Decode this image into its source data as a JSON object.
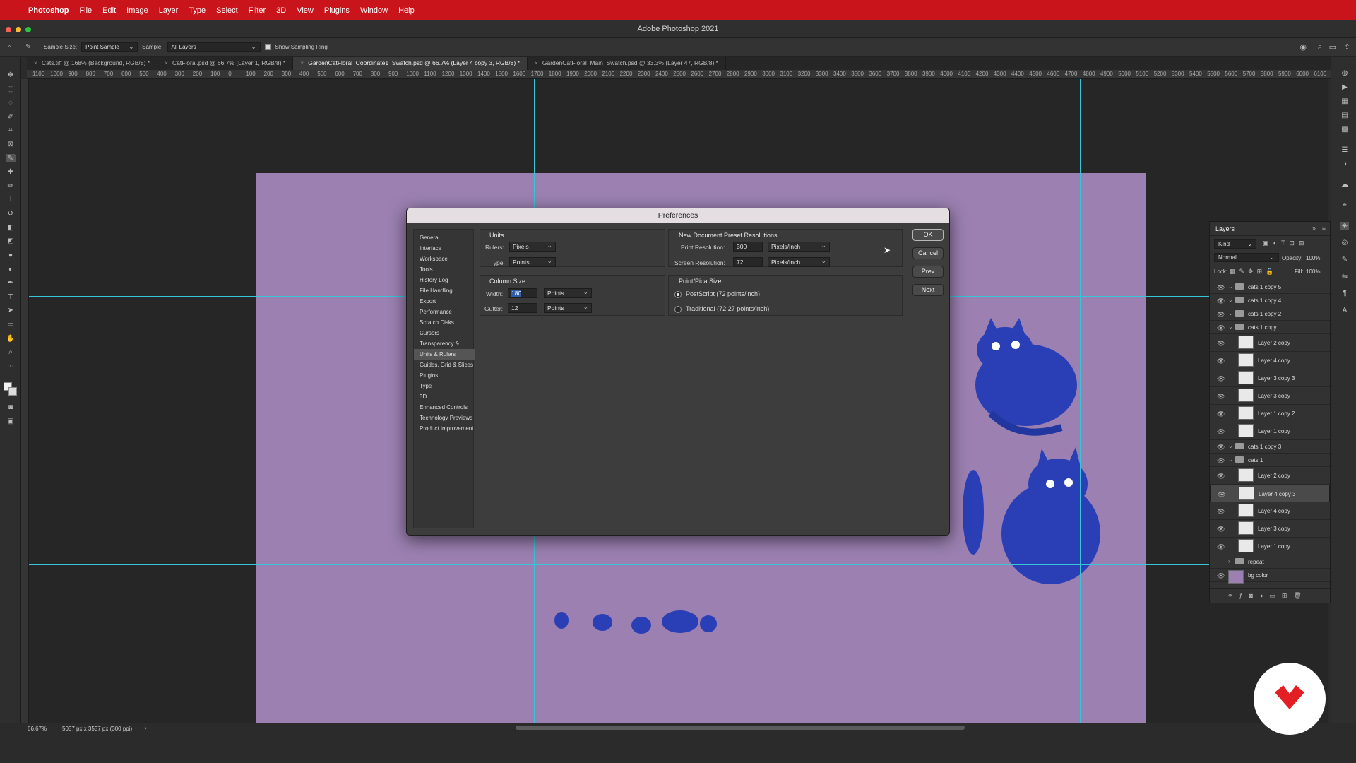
{
  "menubar": {
    "app": "Photoshop",
    "items": [
      "File",
      "Edit",
      "Image",
      "Layer",
      "Type",
      "Select",
      "Filter",
      "3D",
      "View",
      "Plugins",
      "Window",
      "Help"
    ]
  },
  "window": {
    "title": "Adobe Photoshop 2021"
  },
  "options_bar": {
    "sample_size_label": "Sample Size:",
    "sample_size_value": "Point Sample",
    "sample_label": "Sample:",
    "sample_value": "All Layers",
    "show_ring_label": "Show Sampling Ring"
  },
  "tabs": [
    "Cats.tiff @ 168% (Background, RGB/8) *",
    "CatFloral.psd @ 66.7% (Layer 1, RGB/8) *",
    "GardenCatFloral_Coordinate1_Swatch.psd @ 66.7% (Layer 4 copy 3, RGB/8) *",
    "GardenCatFloral_Main_Swatch.psd @ 33.3% (Layer 47, RGB/8) *"
  ],
  "ruler_ticks": [
    "1100",
    "1000",
    "900",
    "800",
    "700",
    "600",
    "500",
    "400",
    "300",
    "200",
    "100",
    "0",
    "100",
    "200",
    "300",
    "400",
    "500",
    "600",
    "700",
    "800",
    "900",
    "1000",
    "1100",
    "1200",
    "1300",
    "1400",
    "1500",
    "1600",
    "1700",
    "1800",
    "1900",
    "2000",
    "2100",
    "2200",
    "2300",
    "2400",
    "2500",
    "2600",
    "2700",
    "2800",
    "2900",
    "3000",
    "3100",
    "3200",
    "3300",
    "3400",
    "3500",
    "3600",
    "3700",
    "3800",
    "3900",
    "4000",
    "4100",
    "4200",
    "4300",
    "4400",
    "4500",
    "4600",
    "4700",
    "4800",
    "4900",
    "5000",
    "5100",
    "5200",
    "5300",
    "5400",
    "5500",
    "5600",
    "5700",
    "5800",
    "5900",
    "6000",
    "6100"
  ],
  "dialog": {
    "title": "Preferences",
    "categories": [
      "General",
      "Interface",
      "Workspace",
      "Tools",
      "History Log",
      "File Handling",
      "Export",
      "Performance",
      "Scratch Disks",
      "Cursors",
      "Transparency & Gamut",
      "Units & Rulers",
      "Guides, Grid & Slices",
      "Plugins",
      "Type",
      "3D",
      "Enhanced Controls",
      "Technology Previews",
      "Product Improvement"
    ],
    "active_category": "Units & Rulers",
    "units": {
      "title": "Units",
      "rulers_label": "Rulers:",
      "rulers_value": "Pixels",
      "type_label": "Type:",
      "type_value": "Points"
    },
    "column_size": {
      "title": "Column Size",
      "width_label": "Width:",
      "width_value": "180",
      "width_unit": "Points",
      "gutter_label": "Gutter:",
      "gutter_value": "12",
      "gutter_unit": "Points"
    },
    "resolutions": {
      "title": "New Document Preset Resolutions",
      "print_label": "Print Resolution:",
      "print_value": "300",
      "print_unit": "Pixels/Inch",
      "screen_label": "Screen Resolution:",
      "screen_value": "72",
      "screen_unit": "Pixels/Inch"
    },
    "point_size": {
      "title": "Point/Pica Size",
      "postscript": "PostScript (72 points/inch)",
      "traditional": "Traditional (72.27 points/inch)",
      "selected": "postscript"
    },
    "buttons": {
      "ok": "OK",
      "cancel": "Cancel",
      "prev": "Prev",
      "next": "Next"
    }
  },
  "layers_panel": {
    "title": "Layers",
    "filter": "Kind",
    "blend_mode": "Normal",
    "opacity_label": "Opacity:",
    "opacity_value": "100%",
    "lock_label": "Lock:",
    "fill_label": "Fill:",
    "fill_value": "100%",
    "rows": [
      {
        "name": "cats 1 copy 5",
        "type": "group"
      },
      {
        "name": "cats 1 copy 4",
        "type": "group"
      },
      {
        "name": "cats 1 copy 2",
        "type": "group"
      },
      {
        "name": "cats 1 copy",
        "type": "group"
      },
      {
        "name": "Layer 2 copy",
        "type": "layer"
      },
      {
        "name": "Layer 4 copy",
        "type": "layer"
      },
      {
        "name": "Layer 3 copy 3",
        "type": "layer"
      },
      {
        "name": "Layer 3 copy",
        "type": "layer"
      },
      {
        "name": "Layer 1 copy 2",
        "type": "layer"
      },
      {
        "name": "Layer 1 copy",
        "type": "layer"
      },
      {
        "name": "cats 1 copy 3",
        "type": "group"
      },
      {
        "name": "cats 1",
        "type": "group"
      },
      {
        "name": "Layer 2 copy",
        "type": "layer"
      },
      {
        "name": "Layer 4 copy 3",
        "type": "layer",
        "selected": true
      },
      {
        "name": "Layer 4 copy",
        "type": "layer"
      },
      {
        "name": "Layer 3 copy",
        "type": "layer"
      },
      {
        "name": "Layer 1 copy",
        "type": "layer"
      },
      {
        "name": "repeat",
        "type": "group"
      },
      {
        "name": "bg color",
        "type": "fill"
      }
    ]
  },
  "status_bar": {
    "zoom": "66.67%",
    "doc_info": "5037 px x 3537 px (300 ppi)"
  },
  "colors": {
    "menubar": "#c8141a",
    "canvas": "#9b80b1",
    "guide": "#36c6d8",
    "cat": "#2a3fb5"
  }
}
